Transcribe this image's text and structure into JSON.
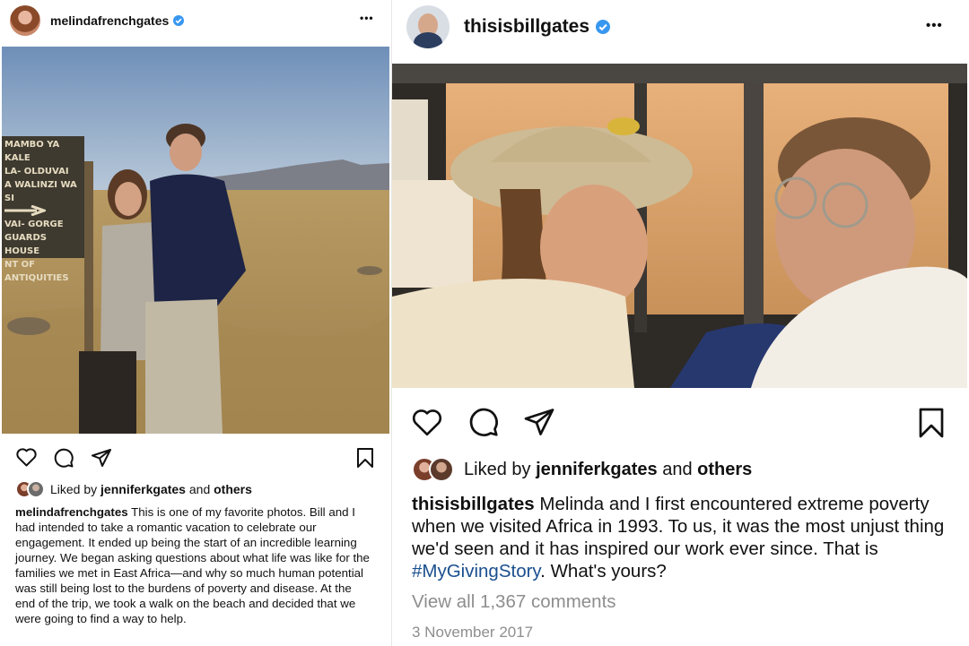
{
  "left_post": {
    "username": "melindafrenchgates",
    "more_label": "•••",
    "liked_prefix": "Liked by",
    "liked_user": "jenniferkgates",
    "liked_and": "and",
    "liked_others": "others",
    "caption_user": "melindafrenchgates",
    "caption_text": "This is one of my favorite photos. Bill and I had intended to take a romantic vacation to celebrate our engagement. It ended up being the start of an incredible learning journey. We began asking questions about what life was like for the families we met in East Africa—and why so much human potential was still being lost to the burdens of poverty and disease. At the end of the trip, we took a walk on the beach and decided that we were going to find a way to help.",
    "sign_lines": [
      "MAMBO YA KALE",
      "LA- OLDUVAI",
      "A WALINZI WA SI",
      "VAI- GORGE",
      "GUARDS HOUSE",
      "NT OF ANTIQUITIES"
    ]
  },
  "right_post": {
    "username": "thisisbillgates",
    "more_label": "•••",
    "liked_prefix": "Liked by",
    "liked_user": "jenniferkgates",
    "liked_and": "and",
    "liked_others": "others",
    "caption_user": "thisisbillgates",
    "caption_text": "Melinda and I first encountered extreme poverty when we visited Africa in 1993. To us, it was the most unjust thing we'd seen and it has inspired our work ever since. That is",
    "caption_hashtag": "#MyGivingStory",
    "caption_end": ". What's yours?",
    "comments_link": "View all 1,367 comments",
    "date": "3 November 2017"
  },
  "colors": {
    "verified_blue": "#3897f0",
    "hashtag_blue": "#1b4f8f",
    "muted_gray": "#8e8e8e"
  },
  "icons": [
    "heart-icon",
    "comment-icon",
    "share-icon",
    "bookmark-icon",
    "verified-badge-icon",
    "more-options-icon"
  ]
}
